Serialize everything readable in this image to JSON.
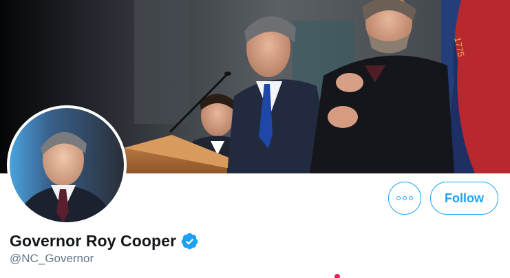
{
  "profile": {
    "display_name": "Governor Roy Cooper",
    "handle": "@NC_Governor",
    "verified": true
  },
  "actions": {
    "more_icon": "more-options-icon",
    "follow_label": "Follow"
  },
  "banner": {
    "flag_text": "1775"
  },
  "colors": {
    "accent": "#1da1f2",
    "name_text": "#14171a",
    "handle_text": "#657786",
    "notification_dot": "#e0245e"
  }
}
